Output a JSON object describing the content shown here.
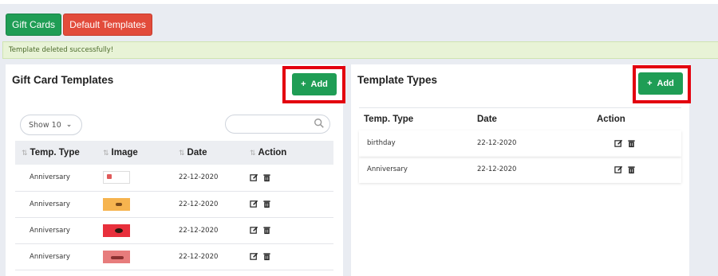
{
  "tabs": {
    "gift_cards": "Gift Cards",
    "default_templates": "Default Templates"
  },
  "alert": {
    "message": "Template deleted successfully!"
  },
  "left_panel": {
    "title": "Gift Card Templates",
    "add_label": "Add",
    "show_select": "Show 10",
    "search_placeholder": "",
    "columns": [
      "Temp. Type",
      "Image",
      "Date",
      "Action"
    ],
    "rows": [
      {
        "type": "Anniversary",
        "image": "template-thumbnail-white",
        "date": "22-12-2020"
      },
      {
        "type": "Anniversary",
        "image": "template-thumbnail-orange",
        "date": "22-12-2020"
      },
      {
        "type": "Anniversary",
        "image": "template-thumbnail-red",
        "date": "22-12-2020"
      },
      {
        "type": "Anniversary",
        "image": "template-thumbnail-pink",
        "date": "22-12-2020"
      }
    ]
  },
  "right_panel": {
    "title": "Template Types",
    "add_label": "Add",
    "columns": [
      "Temp. Type",
      "Date",
      "Action"
    ],
    "rows": [
      {
        "type": "birthday",
        "date": "22-12-2020"
      },
      {
        "type": "Anniversary",
        "date": "22-12-2020"
      }
    ]
  },
  "colors": {
    "primary_green": "#1f9d55",
    "danger_red": "#e24b3b",
    "highlight_red": "#e3000f",
    "alert_bg": "#e8f3d6"
  },
  "icons": {
    "edit": "edit-icon",
    "delete": "trash-icon",
    "search": "search-icon",
    "sort": "sort-icon",
    "plus": "plus-icon",
    "chevron": "chevron-down-icon"
  }
}
